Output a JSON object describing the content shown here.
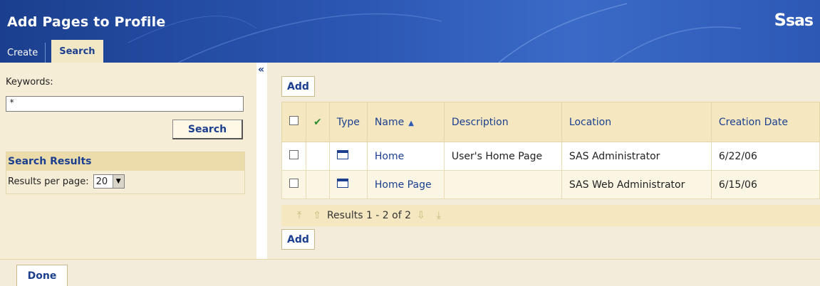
{
  "header": {
    "title": "Add Pages to Profile",
    "logo": "sas",
    "logo_mark": "S"
  },
  "tabs": [
    {
      "label": "Create",
      "active": false
    },
    {
      "label": "Search",
      "active": true
    }
  ],
  "left": {
    "collapse_icon": "«",
    "keywords_label": "Keywords:",
    "keywords_value": "*",
    "search_button": "Search",
    "results_title": "Search Results",
    "results_per_page_label": "Results per page:",
    "results_per_page_value": "20"
  },
  "main": {
    "add_button": "Add",
    "columns": {
      "type": "Type",
      "name": "Name",
      "description": "Description",
      "location": "Location",
      "creation_date": "Creation Date"
    },
    "rows": [
      {
        "name": "Home",
        "description": "User's Home Page",
        "location": "SAS Administrator",
        "creation_date": "6/22/06"
      },
      {
        "name": "Home Page",
        "description": "",
        "location": "SAS Web Administrator",
        "creation_date": "6/15/06"
      }
    ],
    "pager_text": "Results 1 - 2 of 2"
  },
  "footer": {
    "done_button": "Done"
  },
  "colors": {
    "header_blue": "#1b3f8e",
    "panel_tan": "#f3ecda",
    "link_blue": "#1b3f8e"
  }
}
